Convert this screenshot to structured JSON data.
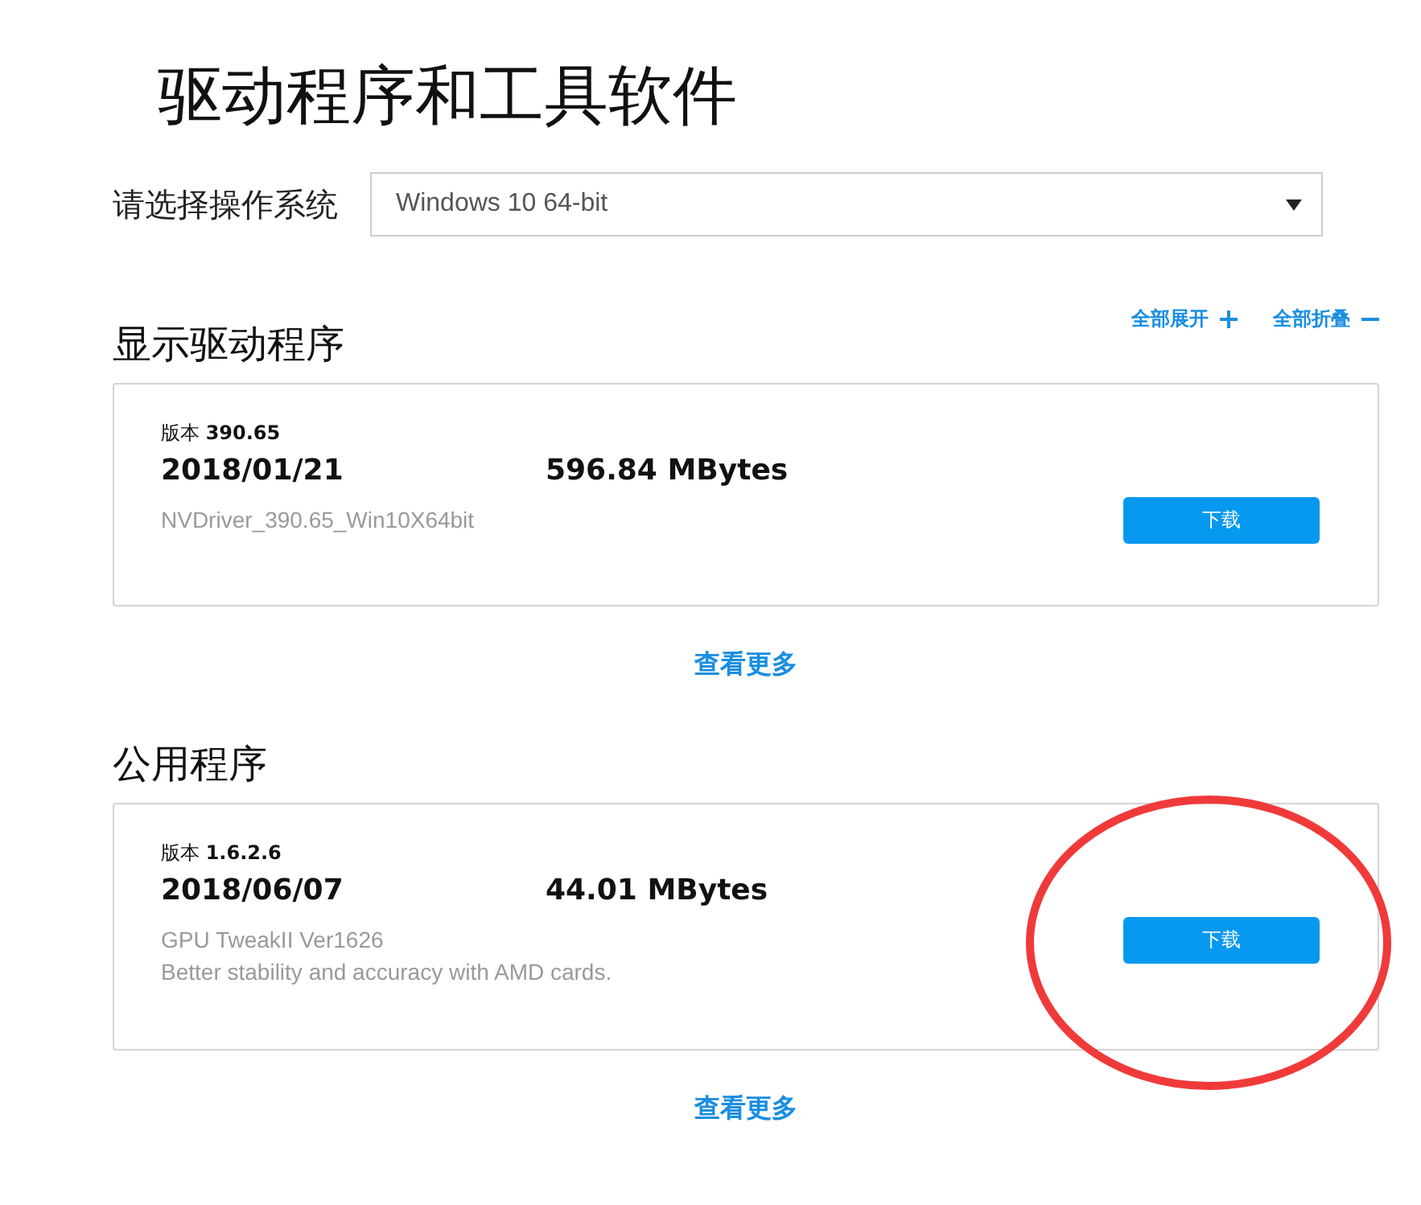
{
  "title": "驱动程序和工具软件",
  "os_select": {
    "label": "请选择操作系统",
    "value": "Windows 10 64-bit"
  },
  "actions": [
    {
      "label": "全部展开",
      "kind": "expand"
    },
    {
      "label": "全部折叠",
      "kind": "collapse"
    }
  ],
  "sections": [
    {
      "heading": "显示驱动程序",
      "items": [
        {
          "version_label": "版本",
          "version": "390.65",
          "date": "2018/01/21",
          "size": "596.84 MBytes",
          "lines": [
            "NVDriver_390.65_Win10X64bit"
          ],
          "button": "下载"
        }
      ],
      "more": "查看更多"
    },
    {
      "heading": "公用程序",
      "items": [
        {
          "version_label": "版本",
          "version": "1.6.2.6",
          "date": "2018/06/07",
          "size": "44.01 MBytes",
          "lines": [
            "GPU TweakII Ver1626",
            "Better stability and accuracy with AMD cards."
          ],
          "button": "下载"
        }
      ],
      "more": "查看更多"
    }
  ]
}
